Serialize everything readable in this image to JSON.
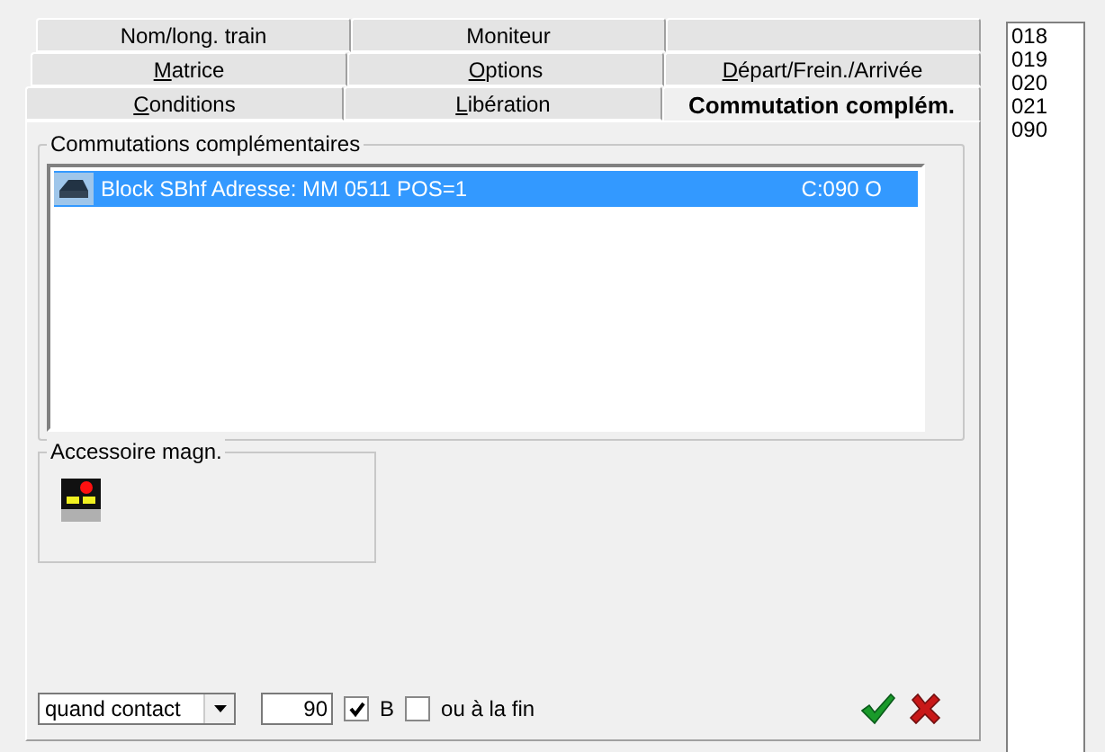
{
  "tab_rows": [
    [
      {
        "pre": "Nom/long. train",
        "selected": false
      },
      {
        "pre": "Moniteur",
        "selected": false
      },
      {
        "selected": false
      }
    ],
    [
      {
        "accel": "M",
        "post": "atrice",
        "selected": false
      },
      {
        "accel": "O",
        "post": "ptions",
        "selected": false
      },
      {
        "accel": "D",
        "post": "épart/Frein./Arrivée",
        "selected": false
      }
    ],
    [
      {
        "accel": "C",
        "post": "onditions",
        "selected": false
      },
      {
        "accel": "L",
        "post": "ibération",
        "selected": false
      },
      {
        "pre": "Commutation complém.",
        "selected": true
      }
    ]
  ],
  "group": {
    "title": "Commutations complémentaires",
    "items": [
      {
        "text": "Block SBhf Adresse: MM 0511 POS=1",
        "code": "C:090 O",
        "selected": true
      }
    ]
  },
  "accessory": {
    "title": "Accessoire magn."
  },
  "bottom": {
    "mode": "quand contact",
    "value": "90",
    "checks": [
      {
        "label": "B",
        "checked": true
      },
      {
        "label": "ou à la fin",
        "checked": false
      }
    ]
  },
  "side_list": [
    {
      "text": "018",
      "selected": false
    },
    {
      "text": "019",
      "selected": false
    },
    {
      "text": "020",
      "selected": false
    },
    {
      "text": "021",
      "selected": false
    },
    {
      "text": "090",
      "selected": false
    }
  ]
}
